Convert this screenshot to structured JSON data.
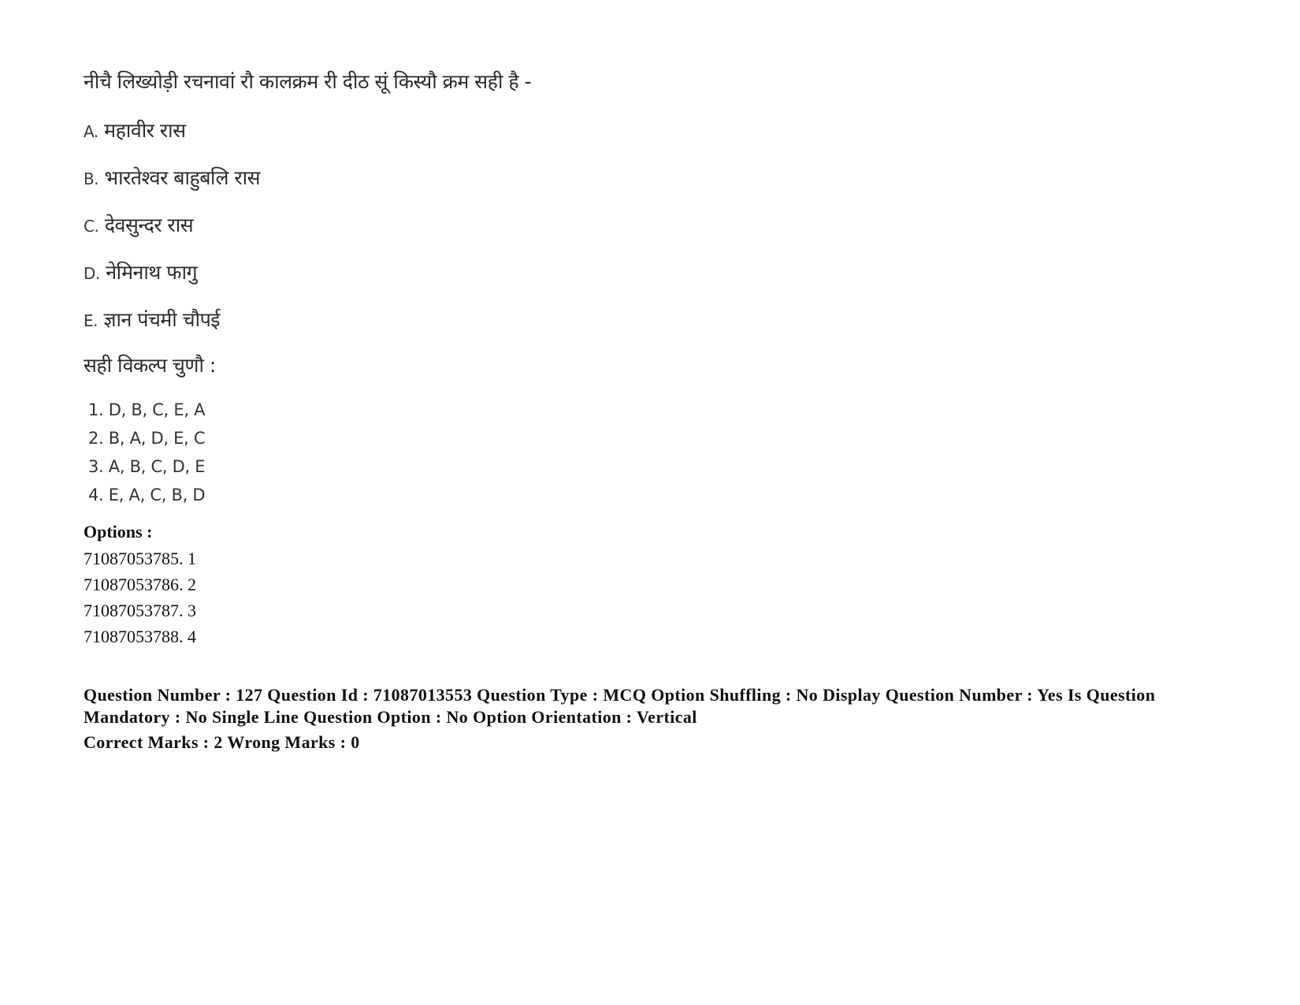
{
  "question": {
    "stem": "नीचै लिख्योड़ी रचनावां रौ कालक्रम री  दीठ सूं किस्यौ क्रम सही है -",
    "items": [
      {
        "label": "A.",
        "text": "महावीर रास"
      },
      {
        "label": "B.",
        "text": "भारतेश्वर बाहुबलि रास"
      },
      {
        "label": "C.",
        "text": "देवसुन्दर रास"
      },
      {
        "label": "D.",
        "text": "नेमिनाथ फागु"
      },
      {
        "label": "E.",
        "text": "ज्ञान पंचमी चौपई"
      }
    ],
    "instruction": "सही विकल्प चुणौ :",
    "choices": [
      "1. D, B, C, E, A",
      "2. B, A, D, E, C",
      "3. A, B, C, D, E",
      "4. E, A, C, B, D"
    ]
  },
  "options": {
    "heading": "Options :",
    "list": [
      "71087053785. 1",
      "71087053786. 2",
      "71087053787. 3",
      "71087053788. 4"
    ]
  },
  "meta": {
    "line1": "Question Number : 127 Question Id : 71087013553 Question Type : MCQ Option Shuffling : No Display Question Number : Yes Is Question Mandatory : No Single Line Question Option : No Option Orientation : Vertical",
    "line2": "Correct Marks : 2 Wrong Marks : 0"
  }
}
